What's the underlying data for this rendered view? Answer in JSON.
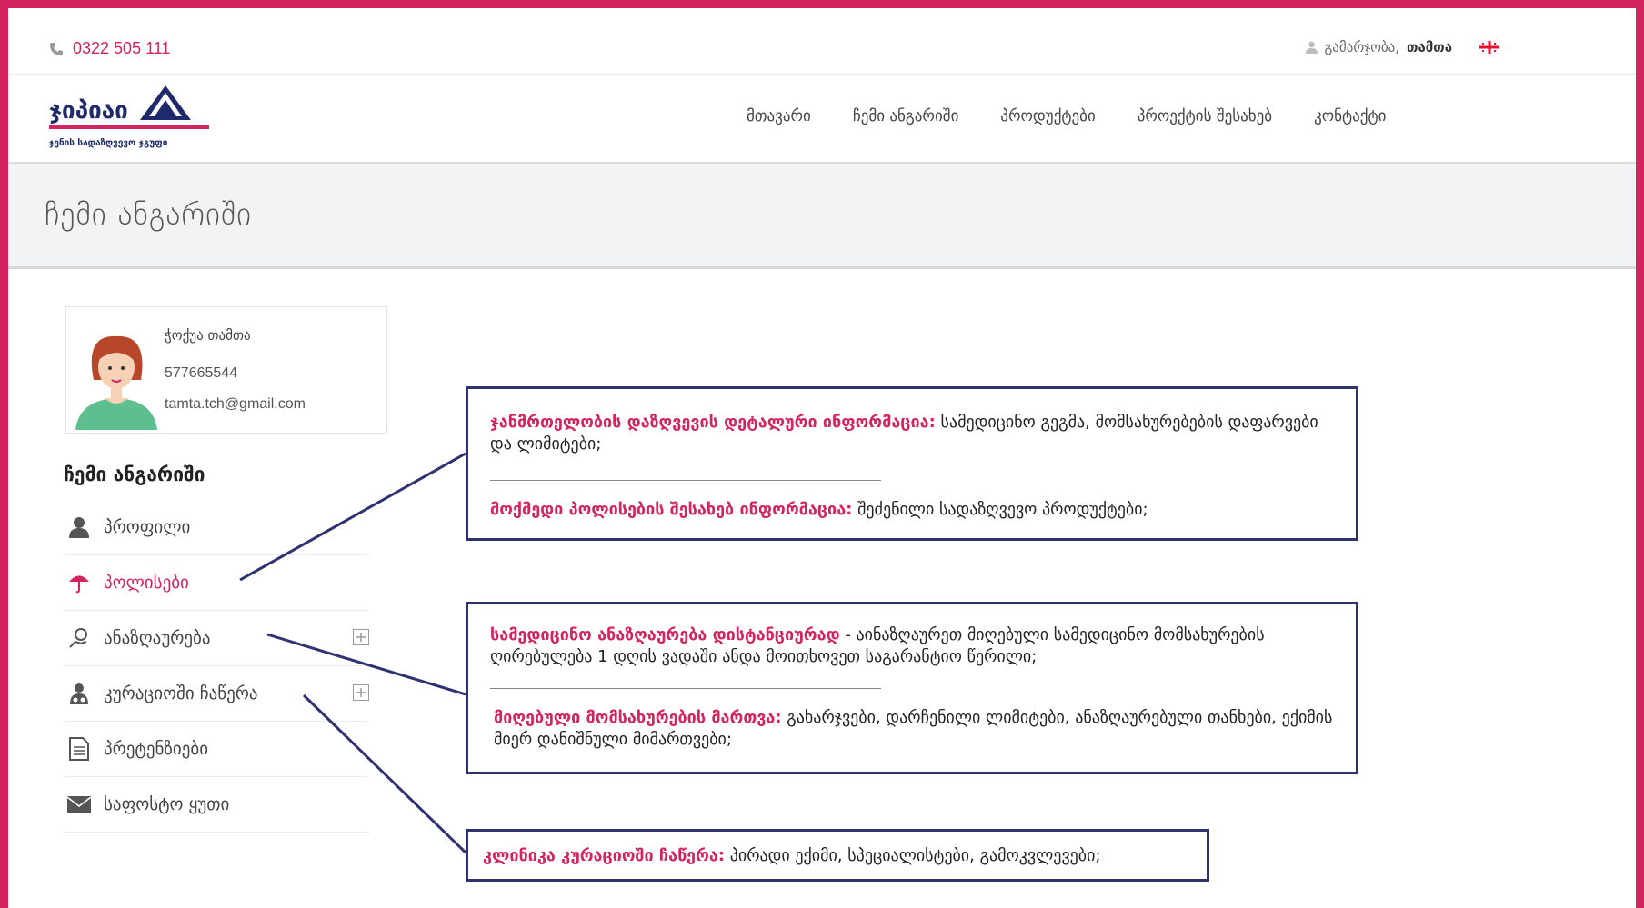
{
  "topbar": {
    "phone": "0322 505 111",
    "logout_label": "გამარჯობა,",
    "username": "თამთა"
  },
  "logo": {
    "text": "ჯიპიაი",
    "subtitle": "ჯენის სადაზღვევო ჯგუფი"
  },
  "nav": {
    "items": [
      "მთავარი",
      "ჩემი ანგარიში",
      "პროდუქტები",
      "პროექტის შესახებ",
      "კონტაქტი"
    ]
  },
  "page": {
    "title": "ჩემი ანგარიში"
  },
  "profile": {
    "name": "ჭოქუა თამთა",
    "phone": "577665544",
    "email": "tamta.tch@gmail.com"
  },
  "account": {
    "heading": "ჩემი ანგარიში",
    "items": [
      {
        "label": "პროფილი",
        "icon": "user-icon"
      },
      {
        "label": "პოლისები",
        "icon": "umbrella-icon"
      },
      {
        "label": "ანაზღაურება",
        "icon": "hand-coin-icon"
      },
      {
        "label": "კურაციოში ჩაწერა",
        "icon": "doctor-icon"
      },
      {
        "label": "პრეტენზიები",
        "icon": "document-icon"
      },
      {
        "label": "საფოსტო ყუთი",
        "icon": "envelope-icon"
      }
    ]
  },
  "callouts": {
    "c1": {
      "h1": "ჯანმრთელობის დაზღვევის დეტალური ინფორმაცია:",
      "t1": " სამედიცინო გეგმა, მომსახურებების დაფარვები და ლიმიტები;",
      "h2": "მოქმედი პოლისების შესახებ ინფორმაცია:",
      "t2": " შეძენილი სადაზღვევო პროდუქტები;"
    },
    "c2": {
      "h1": "სამედიცინო ანაზღაურება დისტანციურად",
      "t1": " - აინაზღაურეთ მიღებული სამედიცინო მომსახურების ღირებულება 1 დღის ვადაში ანდა მოითხოვეთ საგარანტიო წერილი;",
      "h2": "მიღებული მომსახურების მართვა:",
      "t2": "  გახარჯვები, დარჩენილი ლიმიტები, ანაზღაურებული თანხები, ექიმის მიერ დანიშნული მიმართვები;"
    },
    "c3": {
      "h1": "კლინიკა კურაციოში ჩაწერა:",
      "t1": " პირადი ექიმი, სპეციალისტები, გამოკვლევები;"
    }
  },
  "colors": {
    "accent": "#d4245f",
    "callout_border": "#2f3270"
  }
}
